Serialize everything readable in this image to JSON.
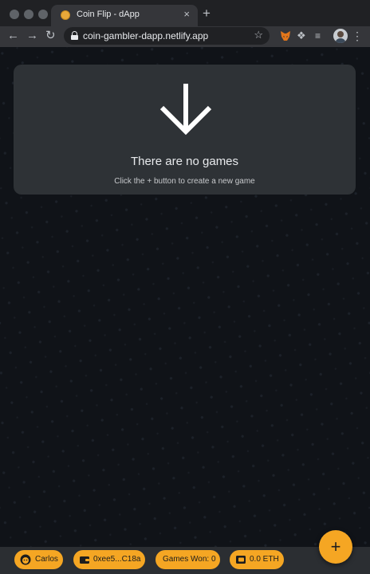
{
  "browser": {
    "tab_title": "Coin Flip - dApp",
    "tab_close": "×",
    "new_tab": "+",
    "url": "coin-gambler-dapp.netlify.app"
  },
  "empty_state": {
    "title": "There are no games",
    "subtitle": "Click the + button to create a new game"
  },
  "footer": {
    "user_chip": "Carlos",
    "address_chip": "0xee5...C18a",
    "games_won_chip": "Games Won: 0",
    "balance_chip": "0.0 ETH"
  },
  "fab": {
    "label": "+"
  },
  "colors": {
    "accent": "#f5a623",
    "card": "#2e3236",
    "background": "#101318"
  }
}
